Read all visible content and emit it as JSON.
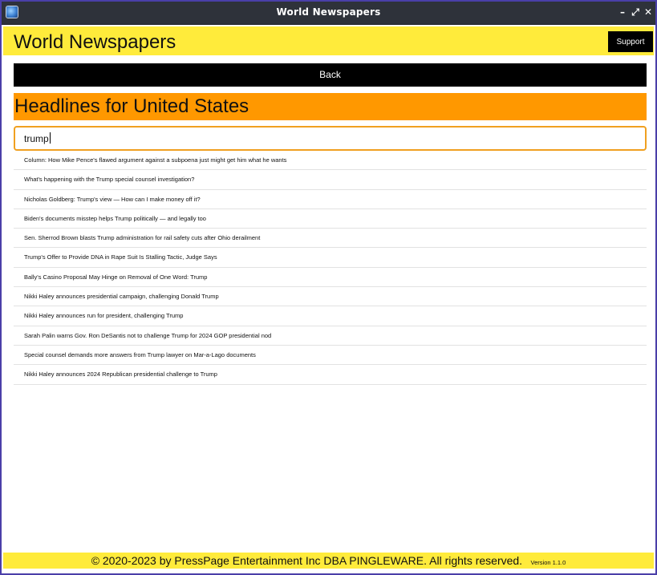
{
  "window": {
    "title": "World Newspapers",
    "controls": {
      "minimize": "–",
      "maximize": "⤢",
      "close": "✕"
    }
  },
  "header": {
    "title": "World Newspapers",
    "support_label": "Support"
  },
  "nav": {
    "back_label": "Back"
  },
  "section": {
    "heading": "Headlines for United States"
  },
  "search": {
    "value": "trump"
  },
  "headlines": [
    "Column: How Mike Pence's flawed argument against a subpoena just might get him what he wants",
    "What's happening with the Trump special counsel investigation?",
    "Nicholas Goldberg: Trump's view — How can I make money off it?",
    "Biden's documents misstep helps Trump politically — and legally too",
    "Sen. Sherrod Brown blasts Trump administration for rail safety cuts after Ohio derailment",
    "Trump's Offer to Provide DNA in Rape Suit Is Stalling Tactic, Judge Says",
    "Bally's Casino Proposal May Hinge on Removal of One Word: Trump",
    "Nikki Haley announces presidential campaign, challenging Donald Trump",
    "Nikki Haley announces run for president, challenging Trump",
    "Sarah Palin warns Gov. Ron DeSantis not to challenge Trump for 2024 GOP presidential nod",
    "Special counsel demands more answers from Trump lawyer on Mar-a-Lago documents",
    "Nikki Haley announces 2024 Republican presidential challenge to Trump"
  ],
  "footer": {
    "copyright": "© 2020-2023 by PressPage Entertainment Inc DBA PINGLEWARE. All rights reserved.",
    "version": "Version 1.1.0"
  },
  "colors": {
    "header_bg": "#ffeb3b",
    "heading_bg": "#ff9800",
    "button_bg": "#000000",
    "titlebar_bg": "#2e323a",
    "search_border": "#f0a020"
  },
  "icons": {
    "app": "globe-icon"
  }
}
